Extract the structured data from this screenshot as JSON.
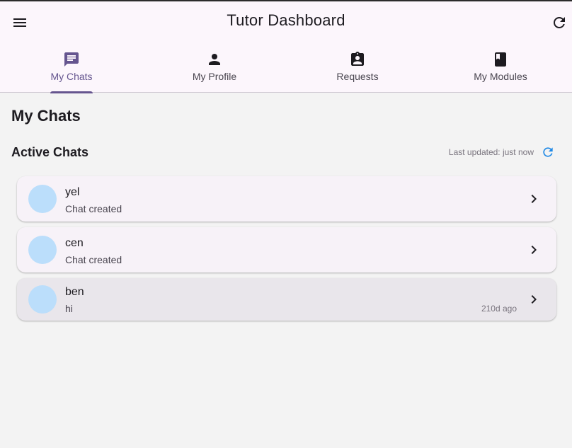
{
  "appbar": {
    "title": "Tutor Dashboard",
    "menu_icon": "menu-icon",
    "refresh_icon": "refresh-icon"
  },
  "tabs": [
    {
      "label": "My Chats",
      "icon": "chat-icon",
      "active": true
    },
    {
      "label": "My Profile",
      "icon": "person-icon",
      "active": false
    },
    {
      "label": "Requests",
      "icon": "assignment-icon",
      "active": false
    },
    {
      "label": "My Modules",
      "icon": "book-icon",
      "active": false
    }
  ],
  "main": {
    "page_title": "My Chats",
    "section_title": "Active Chats",
    "last_updated": "Last updated: just now"
  },
  "chats": [
    {
      "name": "yel",
      "subtitle": "Chat created",
      "time": ""
    },
    {
      "name": "cen",
      "subtitle": "Chat created",
      "time": ""
    },
    {
      "name": "ben",
      "subtitle": "hi",
      "time": "210d ago"
    }
  ],
  "colors": {
    "accent": "#65558f",
    "appbar_bg": "#fcf6fc",
    "page_bg": "#f3f3f3",
    "avatar": "#bbdefb",
    "refresh_blue": "#1e88e5"
  }
}
